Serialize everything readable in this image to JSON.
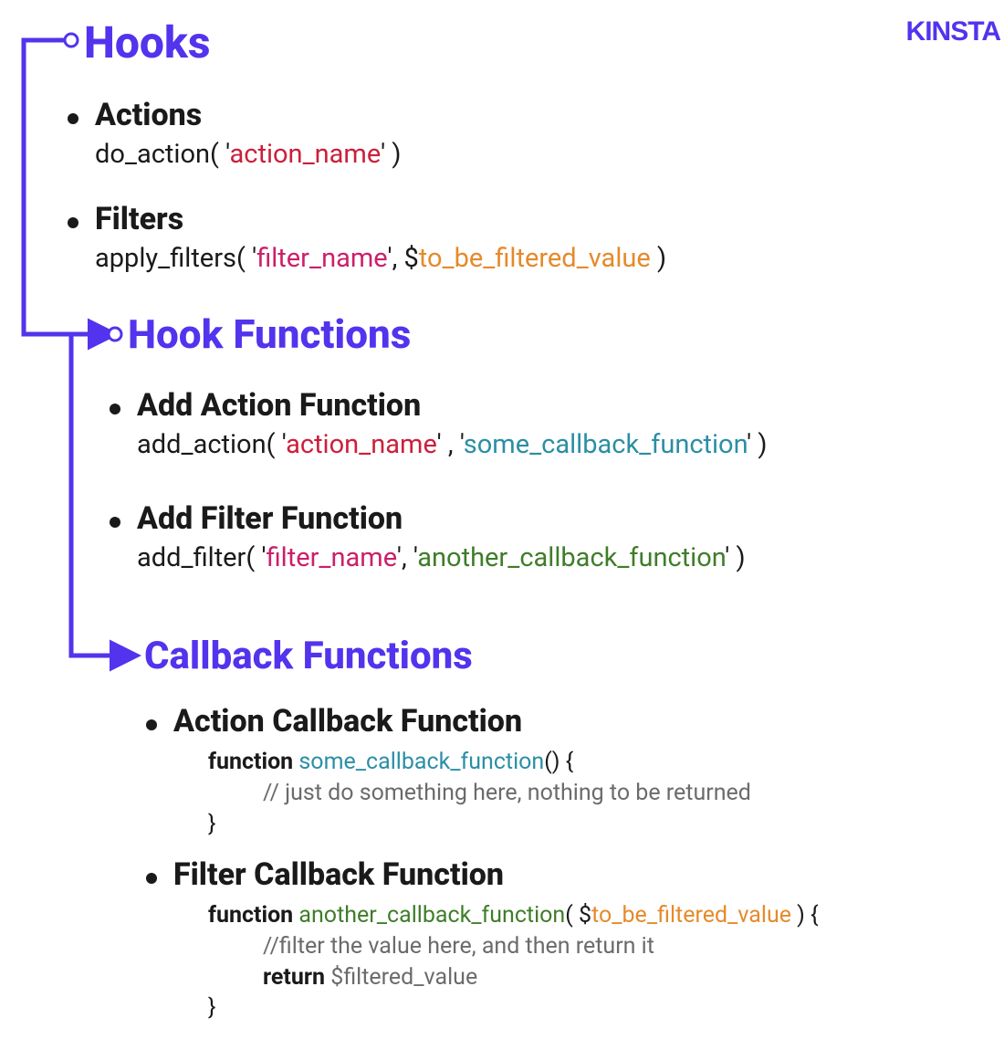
{
  "brand": "KINSTA",
  "section1": {
    "title": "Hooks",
    "actions": {
      "label": "Actions",
      "fn": "do_action",
      "arg_open": "( '",
      "arg": "action_name",
      "arg_close": "' )"
    },
    "filters": {
      "label": "Filters",
      "fn": "apply_filters",
      "p1": "( '",
      "a1": "filter_name",
      "p2": "', $",
      "a2": "to_be_filtered_value",
      "p3": " )"
    }
  },
  "section2": {
    "title": "Hook Functions",
    "addAction": {
      "label": "Add Action Function",
      "fn": "add_action",
      "p1": "( '",
      "a1": "action_name",
      "p2": "' , '",
      "a2": "some_callback_function",
      "p3": "' )"
    },
    "addFilter": {
      "label": "Add Filter Function",
      "fn": "add_filter",
      "p1": "( '",
      "a1": "filter_name",
      "p2": "', '",
      "a2": "another_callback_function",
      "p3": "' )"
    }
  },
  "section3": {
    "title": "Callback Functions",
    "actionCb": {
      "label": "Action Callback Function",
      "kw": "function",
      "name": "some_callback_function",
      "paren": "() {",
      "comment": "// just do something here, nothing to be returned",
      "close": "}"
    },
    "filterCb": {
      "label": "Filter Callback Function",
      "kw": "function",
      "name": "another_callback_function",
      "p1": "( $",
      "arg": "to_be_filtered_value",
      "p2": " ) {",
      "comment": "//filter the value here, and then return it",
      "retkw": "return",
      "retval": " $filtered_value",
      "close": "}"
    }
  }
}
